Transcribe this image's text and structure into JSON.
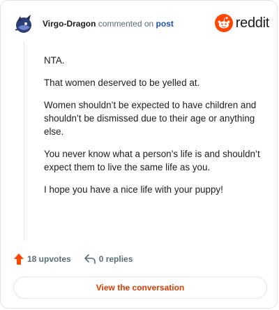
{
  "header": {
    "username": "Virgo-Dragon",
    "action_text": "commented on",
    "post_link": "post",
    "logo_text": "reddit"
  },
  "comment": {
    "paragraphs": [
      "NTA.",
      "That women deserved to be yelled at.",
      "Women shouldn’t be expected to have children and shouldn’t be dismissed due to their age or anything else.",
      "You never know what a person’s life is and shouldn’t expect them to live the same life as you.",
      "I hope you have a nice life with your puppy!"
    ]
  },
  "actions": {
    "upvotes": "18 upvotes",
    "replies": "0 replies"
  },
  "footer": {
    "view_conversation": "View the conversation"
  },
  "colors": {
    "brand": "#ff4500",
    "link": "#1d4fa8",
    "button_text": "#d93a00",
    "muted": "#576f76"
  },
  "icons": {
    "avatar": "dragon-avatar-icon",
    "logo": "reddit-snoo-icon",
    "upvote": "upvote-arrow-icon",
    "reply": "reply-arrow-icon"
  }
}
